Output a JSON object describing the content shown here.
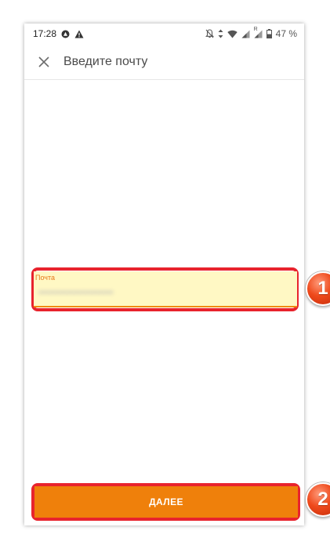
{
  "status_bar": {
    "time": "17:28",
    "left_icons": [
      "autofill-icon",
      "warning-icon"
    ],
    "right_icons": [
      "notifications-off-icon",
      "data-transfer-icon",
      "wifi-icon",
      "signal-icon",
      "roaming-signal-icon",
      "battery-icon"
    ],
    "roaming_mark": "R",
    "battery": "47 %"
  },
  "toolbar": {
    "title": "Введите почту",
    "close_icon": "close-icon"
  },
  "email_field": {
    "label": "Почта",
    "value": "•••••••••••••••••••••"
  },
  "next_button": {
    "label": "ДАЛЕЕ"
  },
  "badges": [
    "1",
    "2"
  ],
  "colors": {
    "accent": "#ef800b",
    "highlight_border": "#e8232d",
    "field_background": "#fff8c4"
  }
}
